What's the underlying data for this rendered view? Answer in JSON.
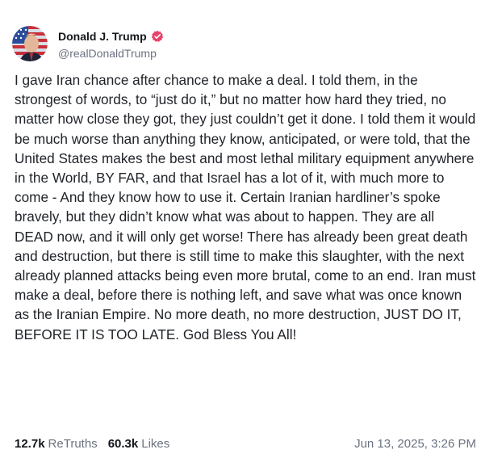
{
  "top_fragment": "",
  "post": {
    "author": {
      "display_name": "Donald J. Trump",
      "handle": "@realDonaldTrump",
      "verified_color": "#e8436b"
    },
    "body": "I gave Iran chance after chance to make a deal. I told them, in the strongest of words, to “just do it,” but no matter how hard they tried, no matter how close they got, they just couldn’t get it done. I told them it would be much worse than anything they know, anticipated, or were told, that the United States makes the best and most lethal military equipment anywhere in the World, BY FAR, and that Israel has a lot of it, with much more to come - And they know how to use it. Certain Iranian hardliner’s spoke bravely, but they didn’t know what was about to happen. They are all DEAD now, and it will only get worse! There has already been great death and destruction, but there is still time to make this slaughter, with the next already planned attacks being even more brutal, come to an end. Iran must make a deal, before there is nothing left, and save what was once known as the Iranian Empire. No more death, no more destruction, JUST DO IT, BEFORE IT IS TOO LATE. God Bless You All!",
    "stats": {
      "retruths_count": "12.7k",
      "retruths_label": "ReTruths",
      "likes_count": "60.3k",
      "likes_label": "Likes"
    },
    "timestamp": "Jun 13, 2025, 3:26 PM"
  }
}
